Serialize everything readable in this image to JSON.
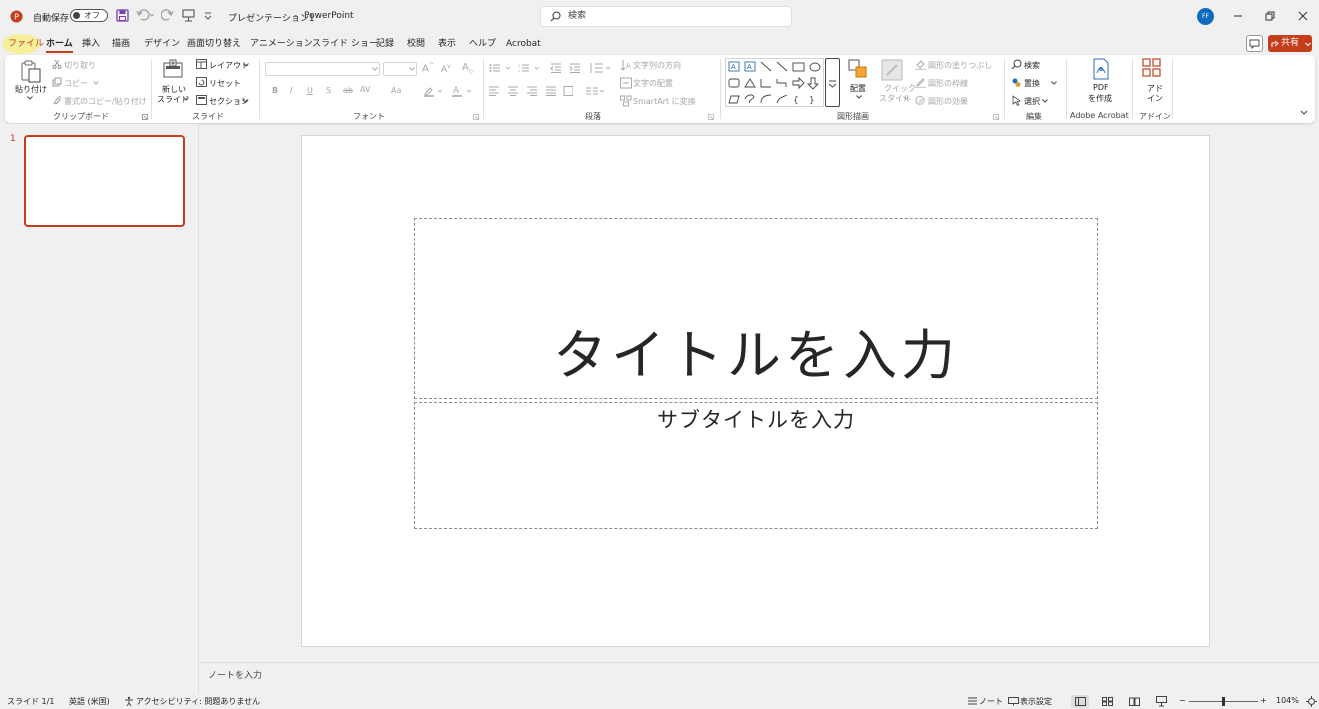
{
  "titlebar": {
    "autosave_label": "自動保存",
    "autosave_state": "オフ",
    "doc_title": "プレゼンテーション1",
    "separator": "-",
    "app_name": "PowerPoint",
    "search_placeholder": "検索",
    "avatar_initials": "FF"
  },
  "tabs": [
    "ファイル",
    "ホーム",
    "挿入",
    "描画",
    "デザイン",
    "画面切り替え",
    "アニメーション",
    "スライド ショー",
    "記録",
    "校閲",
    "表示",
    "ヘルプ",
    "Acrobat"
  ],
  "share_label": "共有",
  "ribbon": {
    "clipboard": {
      "paste": "貼り付け",
      "cut": "切り取り",
      "copy": "コピー",
      "format_painter": "書式のコピー/貼り付け",
      "group": "クリップボード"
    },
    "slides": {
      "new_slide_1": "新しい",
      "new_slide_2": "スライド",
      "layout": "レイアウト",
      "reset": "リセット",
      "section": "セクション",
      "group": "スライド"
    },
    "font": {
      "bold": "B",
      "italic": "I",
      "underline": "U",
      "shadow": "S",
      "strike": "ab",
      "spacing": "AV",
      "case": "Aa",
      "group": "フォント"
    },
    "paragraph": {
      "text_direction": "文字列の方向",
      "align_text": "文字の配置",
      "smartart": "SmartArt に変換",
      "group": "段落"
    },
    "drawing": {
      "arrange": "配置",
      "quick_styles_1": "クイック",
      "quick_styles_2": "スタイル",
      "shape_fill": "図形の塗りつぶし",
      "shape_outline": "図形の枠線",
      "shape_effects": "図形の効果",
      "group": "図形描画"
    },
    "editing": {
      "find": "検索",
      "replace": "置換",
      "select": "選択",
      "group": "編集"
    },
    "acrobat": {
      "pdf_1": "PDF",
      "pdf_2": "を作成",
      "group": "Adobe Acrobat"
    },
    "addins": {
      "label_1": "アド",
      "label_2": "イン",
      "group": "アドイン"
    }
  },
  "thumbnail_number": "1",
  "slide": {
    "title_placeholder": "タイトルを入力",
    "subtitle_placeholder": "サブタイトルを入力"
  },
  "notes_placeholder": "ノートを入力",
  "statusbar": {
    "slide_counter": "スライド 1/1",
    "language": "英語 (米国)",
    "accessibility": "アクセシビリティ: 問題ありません",
    "notes_button": "ノート",
    "display_settings": "表示設定",
    "zoom_minus": "−",
    "zoom_plus": "+",
    "zoom_level": "104%"
  },
  "colors": {
    "accent": "#c43e1c",
    "avatar": "#0f6cbd"
  }
}
